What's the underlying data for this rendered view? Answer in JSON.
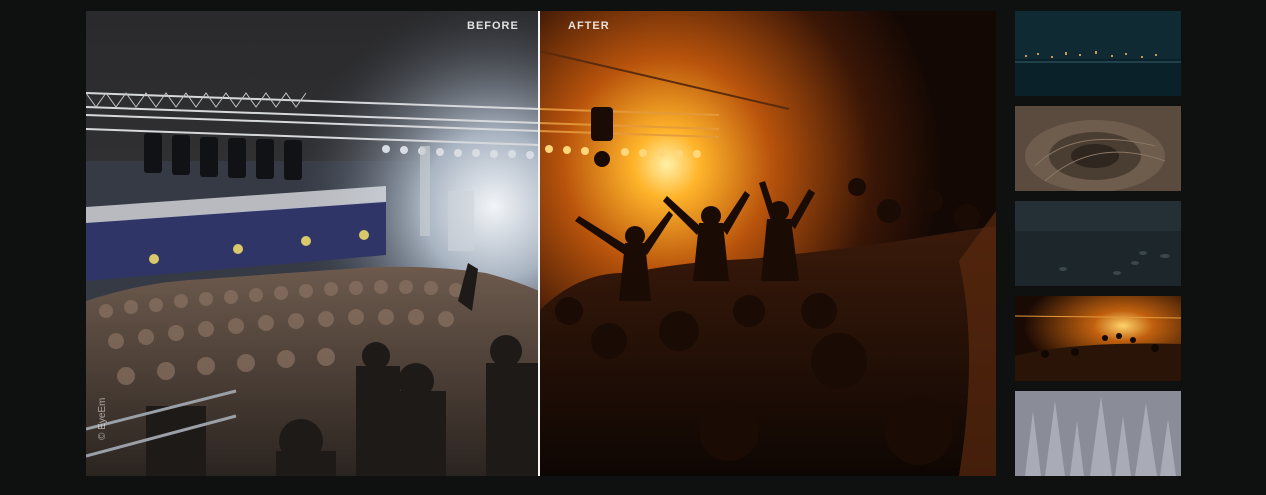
{
  "compare": {
    "before_label": "BEFORE",
    "after_label": "AFTER",
    "credit": "© EyeEm",
    "scene": "concert-crowd"
  },
  "thumbnails": [
    {
      "name": "city-night-waterfront",
      "active": false
    },
    {
      "name": "spiral-staircase",
      "active": false
    },
    {
      "name": "lake-boats-dusk",
      "active": false
    },
    {
      "name": "concert-crowd",
      "active": true
    },
    {
      "name": "frosted-forest",
      "active": false
    }
  ],
  "colors": {
    "background": "#0f1010",
    "divider": "#f4f4f4",
    "after_glow": "#ff9d1a"
  }
}
